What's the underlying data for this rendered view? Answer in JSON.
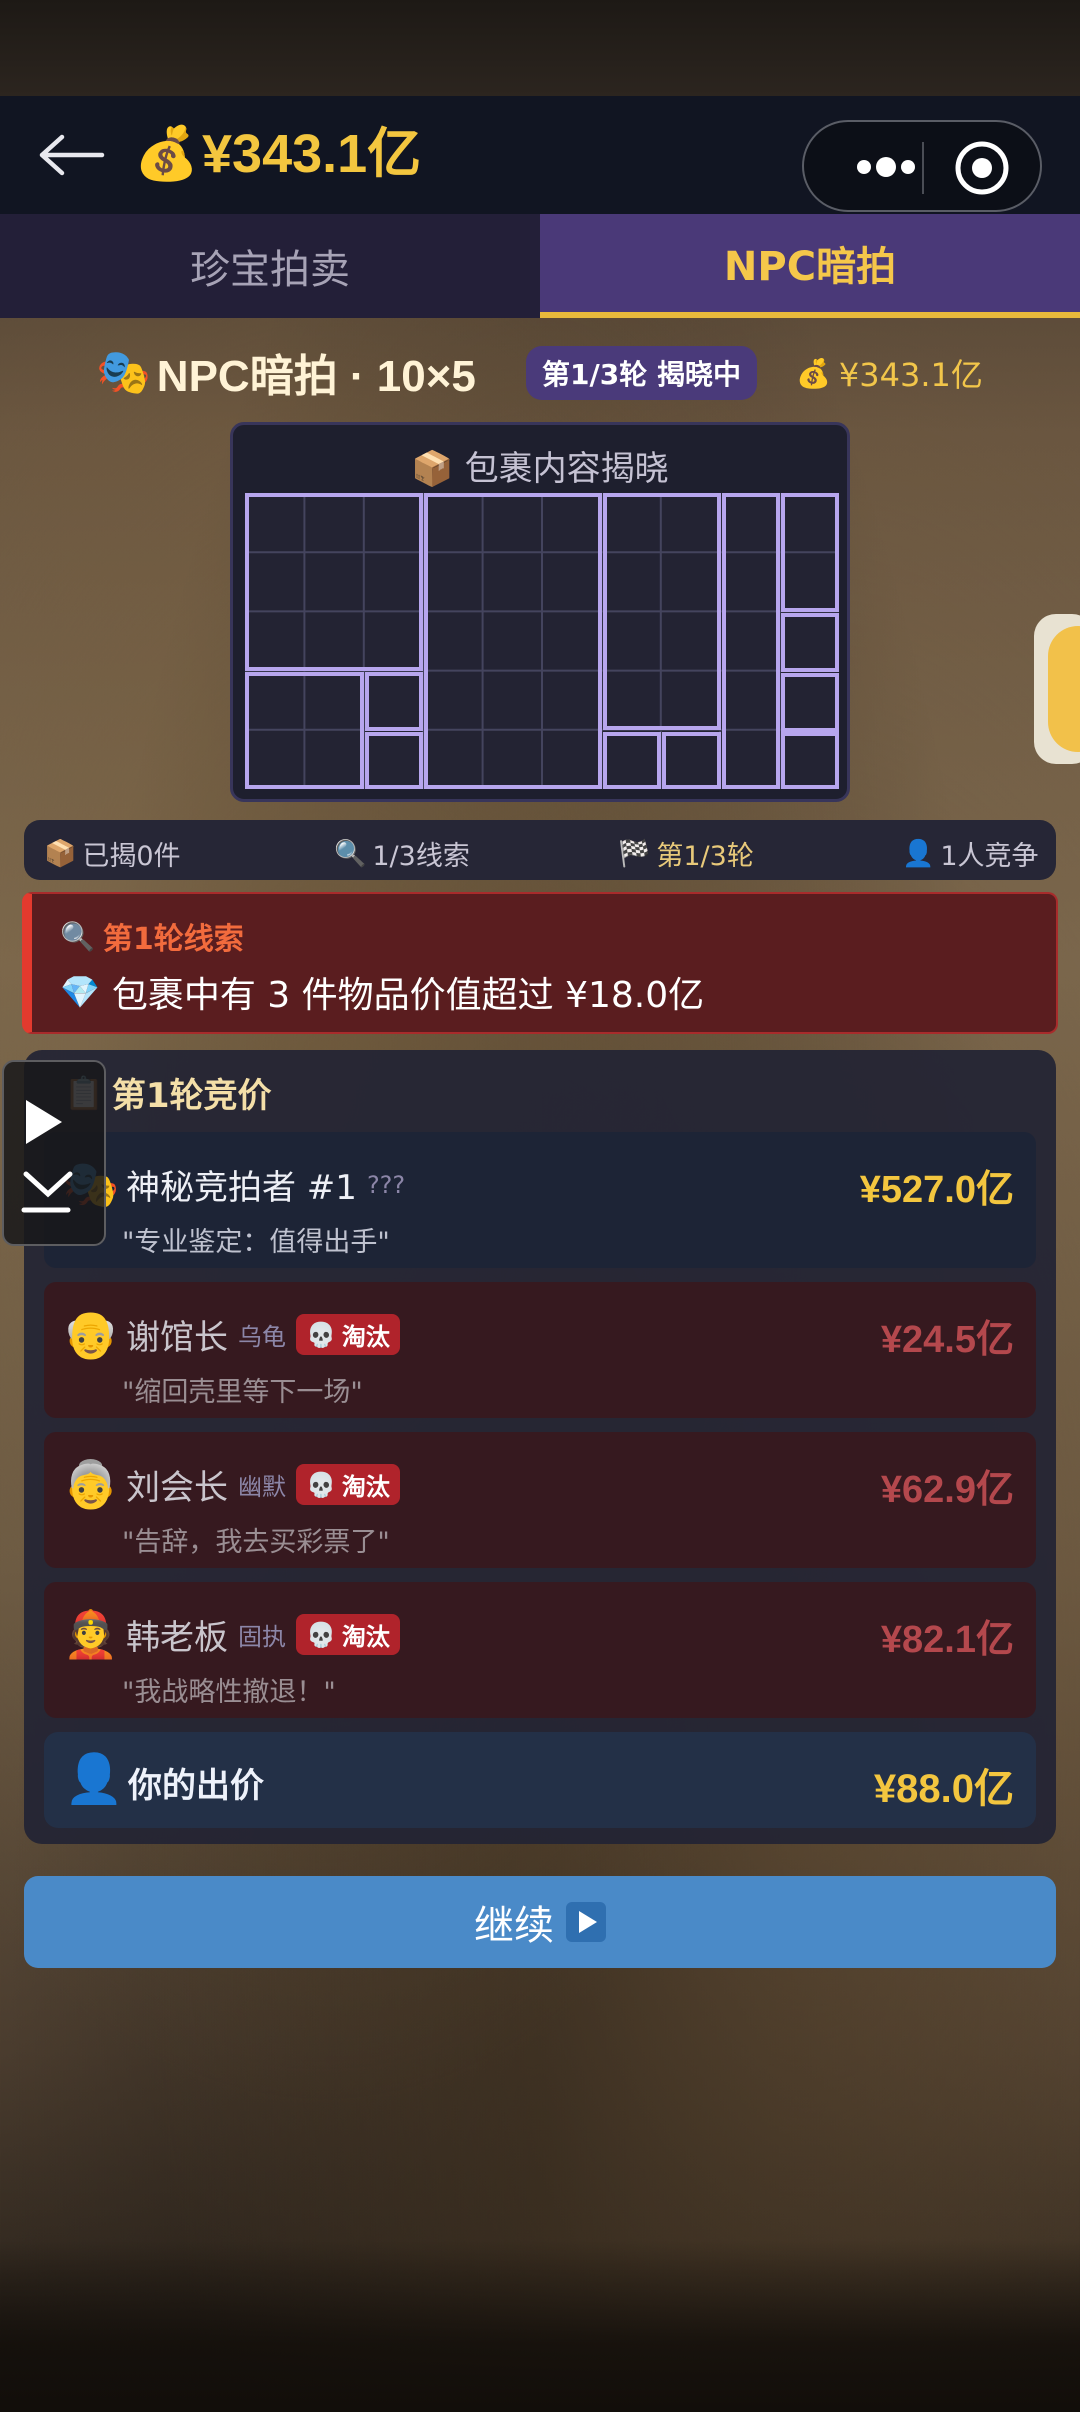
{
  "header": {
    "balance": "¥343.1亿",
    "money_icon": "money-bag-icon",
    "back_icon": "back-arrow-icon"
  },
  "tabs": [
    {
      "label": "珍宝拍卖",
      "active": false
    },
    {
      "label": "NPC暗拍",
      "active": true
    }
  ],
  "title_row": {
    "title": "NPC暗拍 · 10×5",
    "round_badge": "第1/3轮 揭晓中",
    "balance": "¥343.1亿"
  },
  "reveal": {
    "title": "包裹内容揭晓",
    "grid": {
      "cols": 10,
      "rows": 5
    }
  },
  "stats": {
    "revealed": "已揭0件",
    "clues": "1/3线索",
    "round": "第1/3轮",
    "competitors": "1人竞争"
  },
  "clue": {
    "title": "第1轮线索",
    "text": "包裹中有 3 件物品价值超过 ¥18.0亿"
  },
  "bidding": {
    "title": "第1轮竞价",
    "bids": [
      {
        "avatar": "mask-icon",
        "name": "神秘竞拍者 #1",
        "trait": "???",
        "eliminated": false,
        "amount": "¥527.0亿",
        "quote": "\"专业鉴定：值得出手\""
      },
      {
        "avatar": "elder-face-icon",
        "name": "谢馆长",
        "trait": "乌龟",
        "eliminated": true,
        "amount": "¥24.5亿",
        "quote": "\"缩回壳里等下一场\""
      },
      {
        "avatar": "grandma-face-icon",
        "name": "刘会长",
        "trait": "幽默",
        "eliminated": true,
        "amount": "¥62.9亿",
        "quote": "\"告辞，我去买彩票了\""
      },
      {
        "avatar": "helmet-face-icon",
        "name": "韩老板",
        "trait": "固执",
        "eliminated": true,
        "amount": "¥82.1亿",
        "quote": "\"我战略性撤退！\""
      }
    ],
    "elim_label": "淘汰",
    "your_bid_label": "你的出价",
    "your_bid_amount": "¥88.0亿"
  },
  "continue_button": {
    "label": "继续"
  },
  "colors": {
    "accent_gold": "#f3c63f",
    "tab_active": "#4a3978",
    "clue_red": "#e33a2e",
    "button_blue": "#4a8ac8",
    "grid_line": "#b7a6ee"
  }
}
